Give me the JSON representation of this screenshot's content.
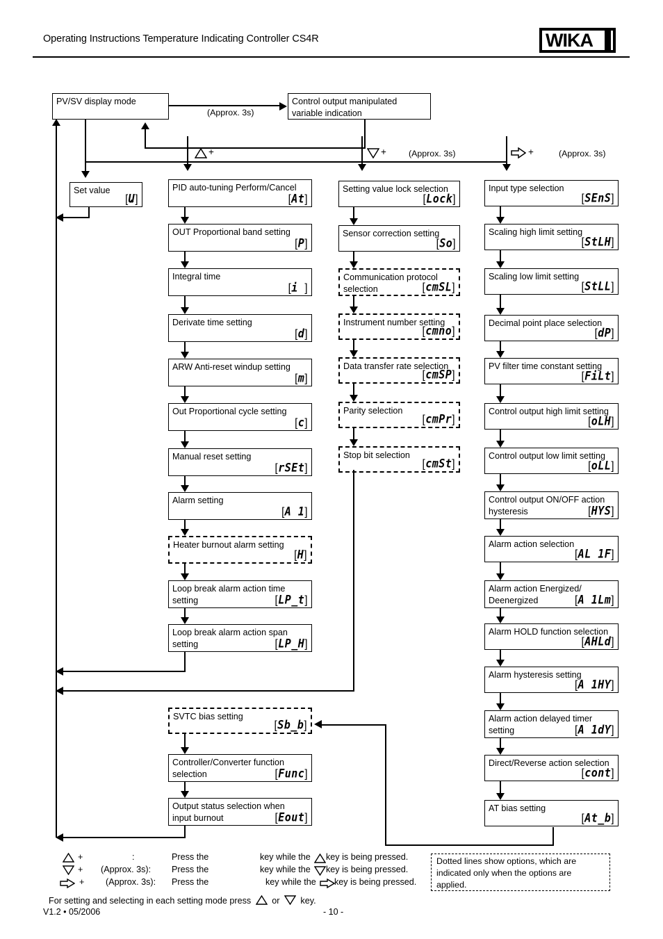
{
  "header": {
    "title": "Operating Instructions Temperature Indicating Controller CS4R",
    "logo": "WIKA"
  },
  "footer": {
    "version": "V1.2 • 05/2006",
    "page": "- 10 -"
  },
  "top_flow": {
    "pv_sv": {
      "label": "PV/SV display mode"
    },
    "approx_label": "(Approx. 3s)",
    "control_output": {
      "line1": "Control output manipulated",
      "line2": "variable indication"
    }
  },
  "branch_labels": [
    {
      "key": "up-triangle",
      "plus": "+",
      "approx": ""
    },
    {
      "key": "down-triangle",
      "plus": "+",
      "approx": "(Approx. 3s)"
    },
    {
      "key": "right-arrow",
      "plus": "+",
      "approx": "(Approx. 3s)"
    }
  ],
  "column_set_value": {
    "title": "Set value",
    "code": "Ա"
  },
  "column_pid": [
    {
      "title": "PID auto-tuning Perform/Cancel",
      "title2": "",
      "code": "At",
      "dashed": false
    },
    {
      "title": "OUT Proportional band setting",
      "title2": "",
      "code": "P",
      "dashed": false
    },
    {
      "title": "Integral time",
      "title2": "",
      "code": "i ",
      "dashed": false
    },
    {
      "title": "Derivate time setting",
      "title2": "",
      "code": "d",
      "dashed": false
    },
    {
      "title": "ARW Anti-reset windup setting",
      "title2": "",
      "code": "m",
      "dashed": false
    },
    {
      "title": "Out Proportional cycle setting",
      "title2": "",
      "code": "c",
      "dashed": false
    },
    {
      "title": "Manual reset setting",
      "title2": "",
      "code": "rSEt",
      "dashed": false
    },
    {
      "title": "Alarm setting",
      "title2": "",
      "code": "A 1",
      "dashed": false
    },
    {
      "title": "Heater burnout alarm setting",
      "title2": "",
      "code": "H",
      "dashed": true
    },
    {
      "title": "Loop break alarm action time",
      "title2": "setting",
      "code": "LP_t",
      "dashed": false
    },
    {
      "title": "Loop break alarm action span",
      "title2": "setting",
      "code": "LP_H",
      "dashed": false
    }
  ],
  "column_comm": [
    {
      "title": "Setting value lock selection",
      "title2": "",
      "code": "Lock",
      "dashed": false
    },
    {
      "title": "Sensor correction setting",
      "title2": "",
      "code": "So",
      "dashed": false
    },
    {
      "title": "Communication protocol",
      "title2": "selection",
      "code": "cmSL",
      "dashed": true
    },
    {
      "title": "Instrument number setting",
      "title2": "",
      "code": "cmno",
      "dashed": true
    },
    {
      "title": "Data transfer rate selection",
      "title2": "",
      "code": "cmSP",
      "dashed": true
    },
    {
      "title": "Parity selection",
      "title2": "",
      "code": "cmPr",
      "dashed": true
    },
    {
      "title": "Stop bit selection",
      "title2": "",
      "code": "cmSt",
      "dashed": true
    }
  ],
  "column_input": [
    {
      "title": "Input type selection",
      "title2": "",
      "code": "SEnS",
      "dashed": false
    },
    {
      "title": "Scaling high limit setting",
      "title2": "",
      "code": "StLH",
      "dashed": false
    },
    {
      "title": "Scaling low limit setting",
      "title2": "",
      "code": "StLL",
      "dashed": false
    },
    {
      "title": "Decimal point place selection",
      "title2": "",
      "code": "dP",
      "dashed": false
    },
    {
      "title": "PV filter time constant setting",
      "title2": "",
      "code": "FiLt",
      "dashed": false
    },
    {
      "title": "Control output high limit setting",
      "title2": "",
      "code": "oLH",
      "dashed": false
    },
    {
      "title": "Control output low limit setting",
      "title2": "",
      "code": "oLL",
      "dashed": false
    },
    {
      "title": "Control output ON/OFF action",
      "title2": "hysteresis",
      "code": "HYS",
      "dashed": false
    },
    {
      "title": "Alarm action selection",
      "title2": "",
      "code": "AL 1F",
      "dashed": false
    },
    {
      "title": "Alarm action Energized/",
      "title2": "Deenergized",
      "code": "A 1Lm",
      "dashed": false
    },
    {
      "title": "Alarm HOLD function selection",
      "title2": "",
      "code": "AHLd",
      "dashed": false
    },
    {
      "title": "Alarm hysteresis setting",
      "title2": "",
      "code": "A 1HY",
      "dashed": false
    },
    {
      "title": "Alarm action delayed timer",
      "title2": "setting",
      "code": "A 1dY",
      "dashed": false
    },
    {
      "title": "Direct/Reverse action selection",
      "title2": "",
      "code": "cont",
      "dashed": false
    },
    {
      "title": "AT bias setting",
      "title2": "",
      "code": "At_b",
      "dashed": false
    }
  ],
  "column_bottom": [
    {
      "title": "SVTC bias setting",
      "title2": "",
      "code": "Sb_b",
      "dashed": true
    },
    {
      "title": "Controller/Converter function",
      "title2": "selection",
      "code": "Func",
      "dashed": false
    },
    {
      "title": "Output status selection when",
      "title2": "input burnout",
      "code": "Eout",
      "dashed": false
    }
  ],
  "legend": {
    "rows": [
      {
        "sym": "up-triangle",
        "plus": "+",
        "mid": ":",
        "press": "Press the",
        "tail_a": "key while the",
        "tail_sym": "up-triangle",
        "tail_b": "key is being pressed."
      },
      {
        "sym": "down-triangle",
        "plus": "+",
        "mid": "(Approx. 3s):",
        "press": "Press the",
        "tail_a": "key while the",
        "tail_sym": "down-triangle",
        "tail_b": "key is being pressed."
      },
      {
        "sym": "right-arrow",
        "plus": "+",
        "mid": "(Approx. 3s):",
        "press": "Press the",
        "tail_a": "key while the",
        "tail_sym": "right-arrow",
        "tail_b": "key is being pressed."
      }
    ],
    "final_a": "For setting and selecting in each setting mode press",
    "final_or": "or",
    "final_b": "key.",
    "final_sym1": "up-triangle",
    "final_sym2": "down-triangle"
  },
  "note": {
    "line1": "Dotted lines show options, which are",
    "line2": "indicated only when the options are",
    "line3": "applied."
  },
  "colors": {
    "ink": "#000000",
    "paper": "#ffffff"
  }
}
